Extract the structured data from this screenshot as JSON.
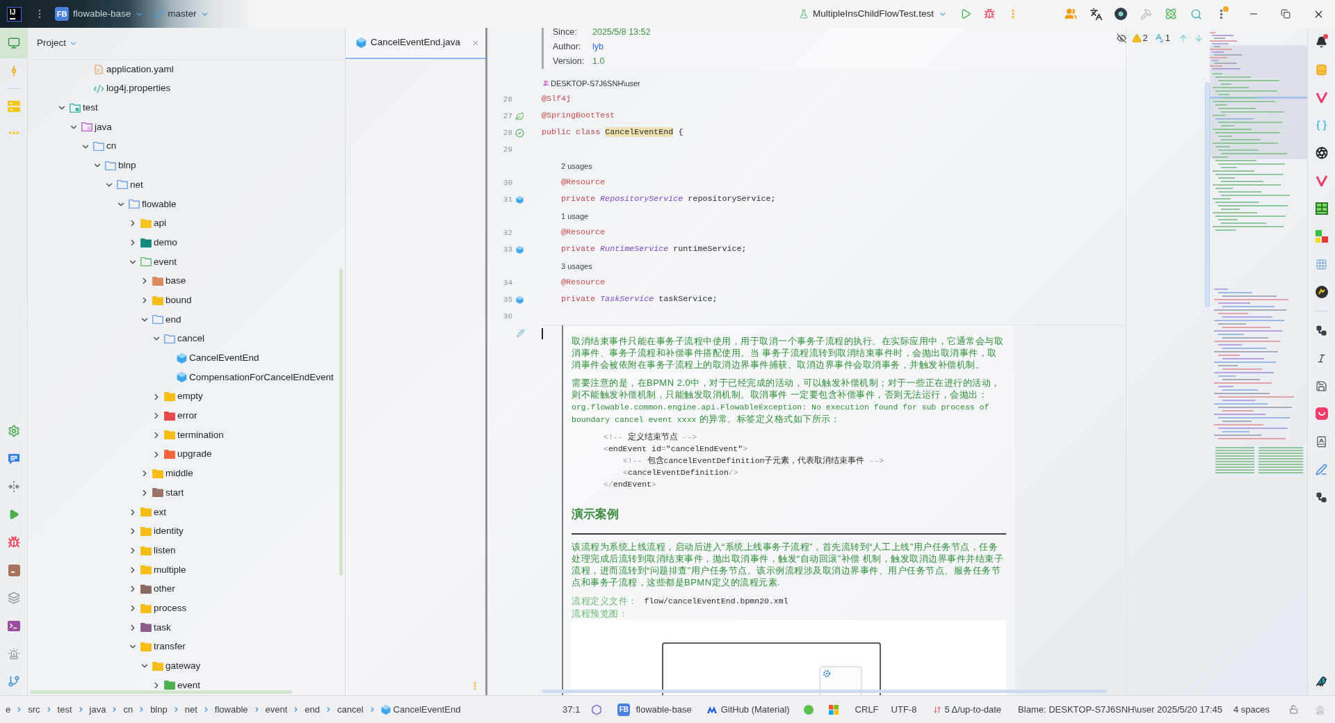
{
  "title_bar": {
    "logo_text": "IJ",
    "project_badge": "FB",
    "project": "flowable-base",
    "branch": "master",
    "run_config": "MultipleInsChildFlowTest.test",
    "updates_badge": true
  },
  "left_toolbar": {
    "top": [
      {
        "kind": "project",
        "selected": true
      },
      {
        "kind": "commit",
        "selected": false
      },
      {
        "kind": "structure",
        "selected": false
      },
      {
        "kind": "more",
        "selected": false
      }
    ],
    "bottom": [
      {
        "kind": "settings",
        "selected": false
      },
      {
        "kind": "chat",
        "selected": false
      },
      {
        "kind": "pull",
        "selected": false
      },
      {
        "kind": "run",
        "selected": false
      },
      {
        "kind": "debug",
        "selected": false
      },
      {
        "kind": "services",
        "selected": false
      },
      {
        "kind": "layers",
        "selected": false
      },
      {
        "kind": "terminal",
        "selected": false
      },
      {
        "kind": "problems",
        "selected": false
      },
      {
        "kind": "git",
        "selected": false
      }
    ]
  },
  "project_panel": {
    "title": "Project",
    "continued_items": [
      {
        "label": "application.yaml",
        "kind": "yaml"
      },
      {
        "label": "log4j.properties",
        "kind": "properties"
      }
    ],
    "tree": [
      {
        "label": "test",
        "kind": "test-root",
        "color": "#3fb5a3",
        "expanded": true,
        "children": [
          {
            "label": "java",
            "kind": "source-root",
            "color": "#c057c9",
            "expanded": true,
            "children": [
              {
                "label": "cn",
                "kind": "package",
                "color": "#6e9fe6",
                "expanded": true,
                "children": [
                  {
                    "label": "blnp",
                    "kind": "package",
                    "color": "#6e9fe6",
                    "expanded": true,
                    "children": [
                      {
                        "label": "net",
                        "kind": "package",
                        "color": "#6e9fe6",
                        "expanded": true,
                        "children": [
                          {
                            "label": "flowable",
                            "kind": "package",
                            "color": "#6e9fe6",
                            "expanded": true,
                            "children": [
                              {
                                "label": "api",
                                "kind": "folder",
                                "color": "#f5c623",
                                "expanded": false
                              },
                              {
                                "label": "demo",
                                "kind": "folder",
                                "color": "#138a7d",
                                "expanded": false
                              },
                              {
                                "label": "event",
                                "kind": "package",
                                "color": "#5fb868",
                                "expanded": true,
                                "children": [
                                  {
                                    "label": "base",
                                    "kind": "folder",
                                    "color": "#d98a5f",
                                    "expanded": false
                                  },
                                  {
                                    "label": "bound",
                                    "kind": "folder",
                                    "color": "#f6bd16",
                                    "expanded": false
                                  },
                                  {
                                    "label": "end",
                                    "kind": "package",
                                    "color": "#6e9fe6",
                                    "expanded": true,
                                    "children": [
                                      {
                                        "label": "cancel",
                                        "kind": "package",
                                        "color": "#6e9fe6",
                                        "expanded": true,
                                        "children": [
                                          {
                                            "label": "CancelEventEnd",
                                            "kind": "class"
                                          },
                                          {
                                            "label": "CompensationForCancelEndEvent",
                                            "kind": "class"
                                          }
                                        ]
                                      },
                                      {
                                        "label": "empty",
                                        "kind": "folder",
                                        "color": "#f6bd16",
                                        "expanded": false
                                      },
                                      {
                                        "label": "error",
                                        "kind": "folder",
                                        "color": "#e5484d",
                                        "expanded": false
                                      },
                                      {
                                        "label": "termination",
                                        "kind": "folder",
                                        "color": "#f6bd16",
                                        "expanded": false
                                      },
                                      {
                                        "label": "upgrade",
                                        "kind": "folder",
                                        "color": "#f2643a",
                                        "expanded": false
                                      }
                                    ]
                                  },
                                  {
                                    "label": "middle",
                                    "kind": "folder",
                                    "color": "#f6bd16",
                                    "expanded": false
                                  },
                                  {
                                    "label": "start",
                                    "kind": "folder",
                                    "color": "#9b7366",
                                    "expanded": false
                                  }
                                ]
                              },
                              {
                                "label": "ext",
                                "kind": "folder",
                                "color": "#f6bd16",
                                "expanded": false
                              },
                              {
                                "label": "identity",
                                "kind": "folder",
                                "color": "#f6bd16",
                                "expanded": false
                              },
                              {
                                "label": "listen",
                                "kind": "folder",
                                "color": "#f6bd16",
                                "expanded": false
                              },
                              {
                                "label": "multiple",
                                "kind": "folder",
                                "color": "#f6bd16",
                                "expanded": false
                              },
                              {
                                "label": "other",
                                "kind": "folder",
                                "color": "#8a6a60",
                                "expanded": false
                              },
                              {
                                "label": "process",
                                "kind": "folder",
                                "color": "#f6bd16",
                                "expanded": false
                              },
                              {
                                "label": "task",
                                "kind": "folder",
                                "color": "#8e5c8c",
                                "expanded": false
                              },
                              {
                                "label": "transfer",
                                "kind": "folder",
                                "color": "#f6bd16",
                                "expanded": true,
                                "children": [
                                  {
                                    "label": "gateway",
                                    "kind": "folder",
                                    "color": "#f6bd16",
                                    "expanded": true,
                                    "children": [
                                      {
                                        "label": "event",
                                        "kind": "folder",
                                        "color": "#4caf50",
                                        "expanded": false
                                      }
                                    ]
                                  }
                                ]
                              }
                            ]
                          }
                        ]
                      }
                    ]
                  }
                ]
              }
            ]
          }
        ]
      }
    ]
  },
  "tabs": [
    {
      "label": "CancelEventEnd.java",
      "selected": true
    }
  ],
  "editor": {
    "doc_tags": [
      {
        "label": "Since:",
        "value": "2025/5/8 13:52",
        "kind": "text"
      },
      {
        "label": "Author:",
        "value": "lyb",
        "kind": "link"
      },
      {
        "label": "Version:",
        "value": "1.0",
        "kind": "text"
      }
    ],
    "author_hint": "DESKTOP-S7J6SNH\\user",
    "lines": [
      {
        "kind": "code",
        "number": "26",
        "tokens": [
          {
            "kind": "annotation",
            "text": "@Slf4j"
          }
        ]
      },
      {
        "kind": "code",
        "number": "27",
        "gutter": {
          "kind": "spring"
        },
        "tokens": [
          {
            "kind": "annotation",
            "text": "@SpringBootTest"
          }
        ]
      },
      {
        "kind": "code",
        "number": "28",
        "gutter": {
          "kind": "run"
        },
        "tokens": [
          {
            "kind": "keyword",
            "text": "public class "
          },
          {
            "kind": "highlight",
            "text": "CancelEventEnd"
          },
          {
            "kind": "plain",
            "text": " {"
          }
        ],
        "children": [
          {
            "kind": "code",
            "number": "29"
          },
          {
            "kind": "hint",
            "text": "2 usages"
          },
          {
            "kind": "code",
            "number": "30",
            "tokens": [
              {
                "kind": "annotation",
                "text": "@Resource"
              }
            ]
          },
          {
            "kind": "code",
            "number": "31",
            "gutter": {
              "kind": "bean"
            },
            "tokens": [
              {
                "kind": "keyword",
                "text": "private "
              },
              {
                "kind": "type",
                "text": "RepositoryService"
              },
              {
                "kind": "plain",
                "text": " repositoryService;"
              }
            ]
          },
          {
            "kind": "hint",
            "text": "1 usage"
          },
          {
            "kind": "code",
            "number": "32",
            "tokens": [
              {
                "kind": "annotation",
                "text": "@Resource"
              }
            ]
          },
          {
            "kind": "code",
            "number": "33",
            "gutter": {
              "kind": "bean"
            },
            "tokens": [
              {
                "kind": "keyword",
                "text": "private "
              },
              {
                "kind": "type",
                "text": "RuntimeService"
              },
              {
                "kind": "plain",
                "text": " runtimeService;"
              }
            ]
          },
          {
            "kind": "hint",
            "text": "3 usages"
          },
          {
            "kind": "code",
            "number": "34",
            "tokens": [
              {
                "kind": "annotation",
                "text": "@Resource"
              }
            ]
          },
          {
            "kind": "code",
            "number": "35",
            "gutter": {
              "kind": "bean"
            },
            "tokens": [
              {
                "kind": "keyword",
                "text": "private "
              },
              {
                "kind": "type",
                "text": "TaskService"
              },
              {
                "kind": "plain",
                "text": " taskService;"
              }
            ]
          }
        ]
      },
      {
        "kind": "code",
        "number": "36"
      }
    ],
    "inspections": {
      "warnings": "2",
      "typos": "1"
    },
    "rendered_doc": [
      {
        "kind": "paragraph",
        "segments": [
          {
            "kind": "text",
            "text": "取消结束事件只能在事务子流程中使用，用于取消一个事务子流程的执行。在实际应用中，它通常会与取消事件、事务子流程和补偿事件搭配使用。当 事务子流程流转到取消结束事件时，会抛出取消事件，取消事件会被依附在事务子流程上的取消边界事件捕获。取消边界事件会取消事务，并触发补偿机制。"
          }
        ]
      },
      {
        "kind": "paragraph",
        "segments": [
          {
            "kind": "text",
            "text": "需要注意的是，在BPMN 2.0中，对于已经完成的活动，可以触发补偿机制；对于一些正在进行的活动，则不能触发补偿机制，只能触发取消机制。取消事件 一定要包含补偿事件，否则无法运行，会抛出："
          },
          {
            "kind": "code",
            "text": "org.flowable.common.engine.api.FlowableException: No execution found for sub process of boundary cancel event xxxx"
          },
          {
            "kind": "text",
            "text": " 的异常。标签定义格式如下所示："
          }
        ]
      },
      {
        "kind": "code",
        "lines": [
          {
            "text": "<!-- 定义结束节点 -->"
          },
          {
            "text": "<endEvent id=\"cancelEndEvent\">",
            "children": [
              {
                "text": "<!-- 包含cancelEventDefinition子元素，代表取消结束事件 -->"
              },
              {
                "text": "<cancelEventDefinition/>"
              }
            ]
          },
          {
            "text": "</endEvent>"
          }
        ]
      },
      {
        "kind": "heading",
        "text": "演示案例"
      },
      {
        "kind": "paragraph",
        "segments": [
          {
            "kind": "text",
            "text": "该流程为系统上线流程，启动后进入“系统上线事务子流程”，首先流转到“人工上线”用户任务节点，任务处理完成后流转到取消结束事件，抛出取消事件，触发“自动回滚”补偿 机制，触发取消边界事件并结束子流程，进而流转到“问题排查”用户任务节点。该示例流程涉及取消边界事件、用户任务节点、服务任务节点和事务子流程，这些都是BPMN定义的流程元素."
          }
        ]
      },
      {
        "kind": "file",
        "label": "流程定义文件：",
        "value": "flow/cancelEventEnd.bpmn20.xml"
      },
      {
        "kind": "preview",
        "label": "流程预览图："
      }
    ]
  },
  "right_toolbar": {
    "unread_notifications": true
  },
  "status_bar": {
    "breadcrumbs": [
      {
        "label": "e",
        "kind": "folder"
      },
      {
        "label": "src",
        "kind": "folder"
      },
      {
        "label": "test",
        "kind": "folder"
      },
      {
        "label": "java",
        "kind": "folder"
      },
      {
        "label": "cn",
        "kind": "folder"
      },
      {
        "label": "blnp",
        "kind": "folder"
      },
      {
        "label": "net",
        "kind": "folder"
      },
      {
        "label": "flowable",
        "kind": "folder"
      },
      {
        "label": "event",
        "kind": "folder"
      },
      {
        "label": "end",
        "kind": "folder"
      },
      {
        "label": "cancel",
        "kind": "folder"
      },
      {
        "label": "CancelEventEnd",
        "kind": "class"
      }
    ],
    "position": "37:1",
    "project_badge": "FB",
    "project": "flowable-base",
    "theme": "GitHub (Material)",
    "line_separator": "CRLF",
    "encoding": "UTF-8",
    "vcs_status": "5 Δ/up-to-date",
    "blame": "Blame: DESKTOP-S7J6SNH\\user 2025/5/20 17:45",
    "indent": "4 spaces"
  }
}
